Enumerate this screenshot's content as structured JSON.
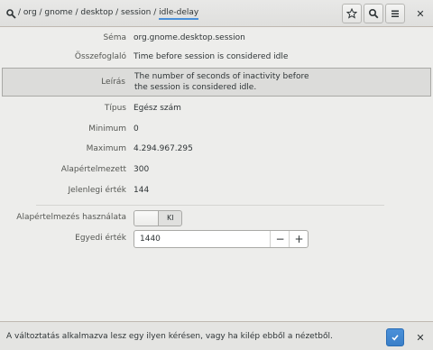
{
  "header": {
    "path_prefix": "/ org / gnome / desktop / session / ",
    "path_current": "idle-delay",
    "icons": [
      "search-key-icon",
      "star-icon",
      "search-icon",
      "menu-icon",
      "close-icon"
    ],
    "accent": "#4a90d9"
  },
  "rows": {
    "schema": {
      "label": "Séma",
      "value": "org.gnome.desktop.session"
    },
    "summary": {
      "label": "Összefoglaló",
      "value": "Time before session is considered idle"
    },
    "description": {
      "label": "Leírás",
      "value": "The number of seconds of inactivity before the session is considered idle."
    },
    "type": {
      "label": "Típus",
      "value": "Egész szám"
    },
    "minimum": {
      "label": "Minimum",
      "value": "0"
    },
    "maximum": {
      "label": "Maximum",
      "value": "4.294.967.295"
    },
    "default": {
      "label": "Alapértelmezett",
      "value": "300"
    },
    "current": {
      "label": "Jelenlegi érték",
      "value": "144"
    }
  },
  "controls": {
    "use_default": {
      "label": "Alapértelmezés használata",
      "state": "KI",
      "on": false
    },
    "custom_value": {
      "label": "Egyedi érték",
      "value": "1440",
      "minus": "−",
      "plus": "+"
    }
  },
  "infobar": {
    "message": "A változtatás alkalmazva lesz egy ilyen kérésen, vagy ha kilép ebből a nézetből.",
    "apply_icon": "checkmark-icon",
    "close_icon": "close-icon"
  }
}
